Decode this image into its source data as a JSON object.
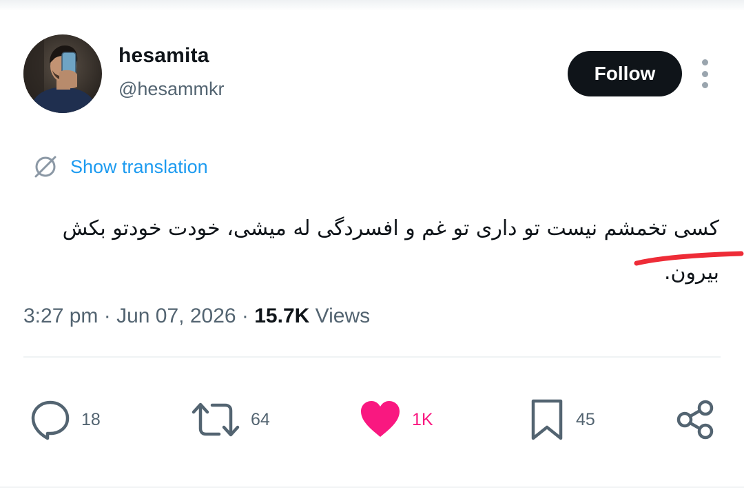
{
  "author": {
    "display_name": "hesamita",
    "handle": "@hesammkr"
  },
  "follow_label": "Follow",
  "translate_label": "Show translation",
  "tweet": {
    "text": "کسی تخمشم نیست تو داری تو غم و افسردگی له میشی، خودت خودتو بکش بیرون."
  },
  "meta": {
    "time": "3:27 pm",
    "sep1": " · ",
    "date": "Jun 07, 2026",
    "sep2": " · ",
    "views_count": "15.7K",
    "views_label": " Views"
  },
  "actions": {
    "replies": "18",
    "reposts": "64",
    "likes": "1K",
    "bookmarks": "45"
  },
  "colors": {
    "like_active": "#f91880",
    "link": "#1d9bf0",
    "highlight_mark": "#ee2c37"
  }
}
